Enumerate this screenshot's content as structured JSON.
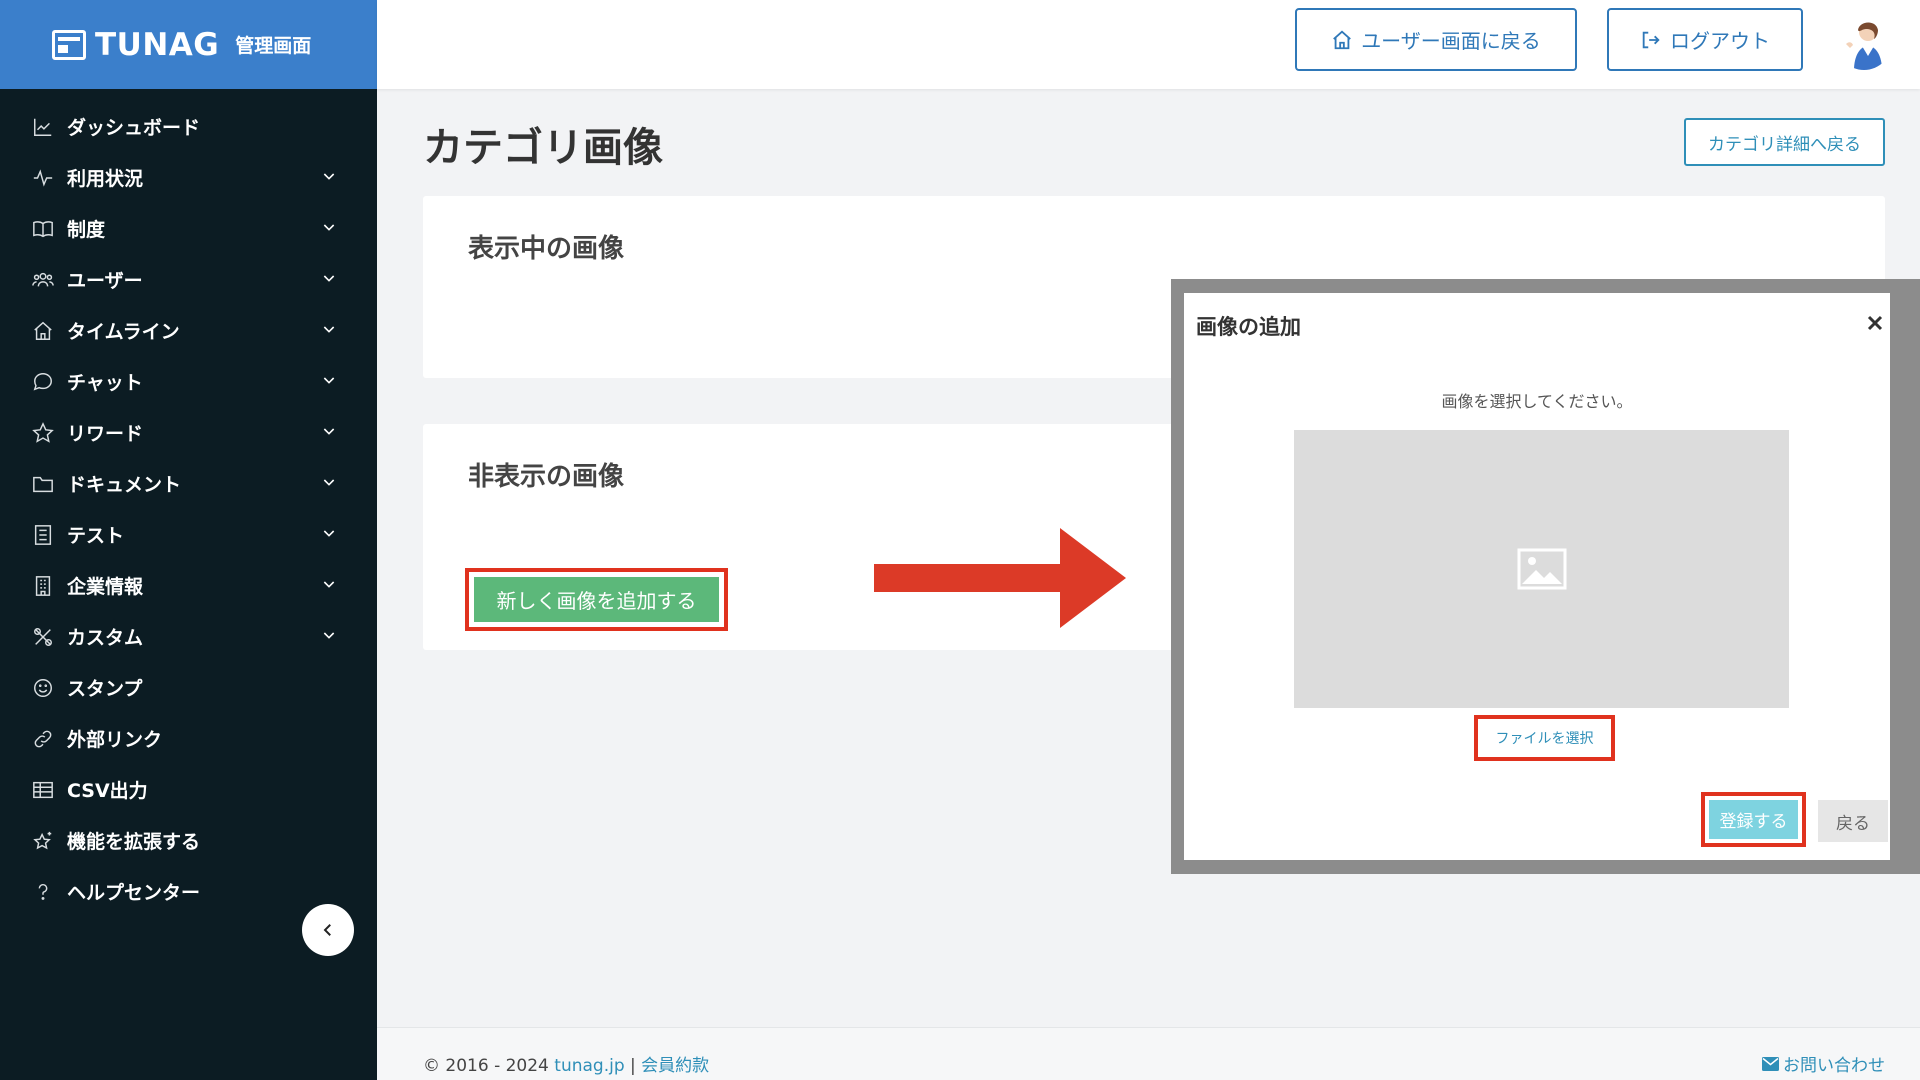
{
  "brand": {
    "name": "TUNAG",
    "subtitle": "管理画面",
    "logo_icon": "tunag-logo-icon"
  },
  "sidebar": {
    "items": [
      {
        "label": "ダッシュボード",
        "icon": "chart-line-icon",
        "expandable": false
      },
      {
        "label": "利用状況",
        "icon": "activity-icon",
        "expandable": true
      },
      {
        "label": "制度",
        "icon": "book-icon",
        "expandable": true
      },
      {
        "label": "ユーザー",
        "icon": "users-icon",
        "expandable": true
      },
      {
        "label": "タイムライン",
        "icon": "home-icon",
        "expandable": true
      },
      {
        "label": "チャット",
        "icon": "chat-bubble-icon",
        "expandable": true
      },
      {
        "label": "リワード",
        "icon": "star-icon",
        "expandable": true
      },
      {
        "label": "ドキュメント",
        "icon": "folder-icon",
        "expandable": true
      },
      {
        "label": "テスト",
        "icon": "checklist-icon",
        "expandable": true
      },
      {
        "label": "企業情報",
        "icon": "building-icon",
        "expandable": true
      },
      {
        "label": "カスタム",
        "icon": "tools-icon",
        "expandable": true
      },
      {
        "label": "スタンプ",
        "icon": "smile-icon",
        "expandable": false
      },
      {
        "label": "外部リンク",
        "icon": "link-icon",
        "expandable": false
      },
      {
        "label": "CSV出力",
        "icon": "table-icon",
        "expandable": false
      },
      {
        "label": "機能を拡張する",
        "icon": "sparkle-star-icon",
        "expandable": false
      },
      {
        "label": "ヘルプセンター",
        "icon": "question-icon",
        "expandable": false
      }
    ]
  },
  "header": {
    "user_screen_label": "ユーザー画面に戻る",
    "logout_label": "ログアウト"
  },
  "main": {
    "title": "カテゴリ画像",
    "back_to_detail_label": "カテゴリ詳細へ戻る",
    "visible_section_title": "表示中の画像",
    "hidden_section_title": "非表示の画像",
    "add_image_label": "新しく画像を追加する"
  },
  "modal": {
    "title": "画像の追加",
    "instruction": "画像を選択してください。",
    "file_select_label": "ファイルを選択",
    "submit_label": "登録する",
    "back_label": "戻る"
  },
  "footer": {
    "copyright": "© 2016 - 2024 ",
    "site_link": "tunag.jp",
    "separator": " | ",
    "terms_link": "会員約款",
    "contact_label": "お問い合わせ"
  },
  "colors": {
    "sidebar_bg": "#0c1c23",
    "brand_bg": "#3b7fcb",
    "accent_blue": "#2f78b8",
    "add_button": "#5cb87a",
    "highlight_red": "#e0321e",
    "submit_button": "#7ed3e0"
  }
}
